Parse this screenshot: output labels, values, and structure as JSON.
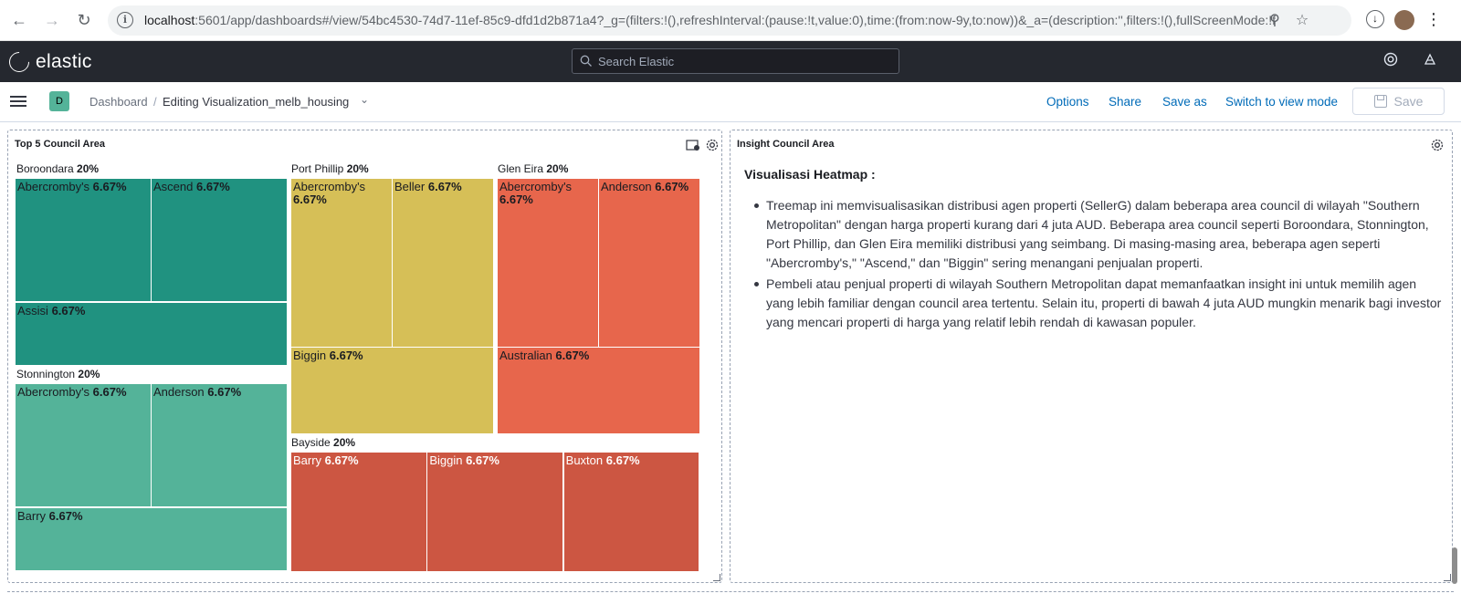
{
  "browser": {
    "url_host": "localhost",
    "url_rest": ":5601/app/dashboards#/view/54bc4530-74d7-11ef-85c9-dfd1d2b871a4?_g=(filters:!(),refreshInterval:(pause:!t,value:0),time:(from:now-9y,to:now))&_a=(description:'',filters:!(),fullScreenMode:!f...."
  },
  "header": {
    "brand": "elastic",
    "search_placeholder": "Search Elastic"
  },
  "breadcrumb": {
    "space_initial": "D",
    "parent": "Dashboard",
    "separator": "/",
    "current": "Editing Visualization_melb_housing"
  },
  "toolbar": {
    "options": "Options",
    "share": "Share",
    "save_as": "Save as",
    "switch_mode": "Switch to view mode",
    "save": "Save"
  },
  "panels": {
    "treemap_title": "Top 5 Council Area",
    "insight_title": "Insight Council Area"
  },
  "chart_data": {
    "type": "treemap",
    "title": "Top 5 Council Area",
    "groups": [
      {
        "name": "Boroondara",
        "pct": "20%",
        "color": "#209280",
        "children": [
          {
            "name": "Abercromby's",
            "pct": "6.67%"
          },
          {
            "name": "Ascend",
            "pct": "6.67%"
          },
          {
            "name": "Assisi",
            "pct": "6.67%"
          }
        ]
      },
      {
        "name": "Stonnington",
        "pct": "20%",
        "color": "#54b399",
        "children": [
          {
            "name": "Abercromby's",
            "pct": "6.67%"
          },
          {
            "name": "Anderson",
            "pct": "6.67%"
          },
          {
            "name": "Barry",
            "pct": "6.67%"
          }
        ]
      },
      {
        "name": "Port Phillip",
        "pct": "20%",
        "color": "#d6bf57",
        "children": [
          {
            "name": "Abercromby's",
            "pct": "6.67%"
          },
          {
            "name": "Beller",
            "pct": "6.67%"
          },
          {
            "name": "Biggin",
            "pct": "6.67%"
          }
        ]
      },
      {
        "name": "Glen Eira",
        "pct": "20%",
        "color": "#e7664c",
        "children": [
          {
            "name": "Abercromby's",
            "pct": "6.67%"
          },
          {
            "name": "Anderson",
            "pct": "6.67%"
          },
          {
            "name": "Australian",
            "pct": "6.67%"
          }
        ]
      },
      {
        "name": "Bayside",
        "pct": "20%",
        "color": "#cc5642",
        "children": [
          {
            "name": "Barry",
            "pct": "6.67%"
          },
          {
            "name": "Biggin",
            "pct": "6.67%"
          },
          {
            "name": "Buxton",
            "pct": "6.67%"
          }
        ]
      }
    ]
  },
  "insight": {
    "heading": "Visualisasi Heatmap :",
    "bullets": [
      "Treemap ini memvisualisasikan distribusi agen properti (SellerG) dalam beberapa area council di wilayah \"Southern Metropolitan\" dengan harga properti kurang dari 4 juta AUD. Beberapa area council seperti Boroondara, Stonnington, Port Phillip, dan Glen Eira memiliki distribusi yang seimbang. Di masing-masing area, beberapa agen seperti \"Abercromby's,\" \"Ascend,\" dan \"Biggin\" sering menangani penjualan properti.",
      "Pembeli atau penjual properti di wilayah Southern Metropolitan dapat memanfaatkan insight ini untuk memilih agen yang lebih familiar dengan council area tertentu. Selain itu, properti di bawah 4 juta AUD mungkin menarik bagi investor yang mencari properti di harga yang relatif lebih rendah di kawasan populer."
    ]
  }
}
